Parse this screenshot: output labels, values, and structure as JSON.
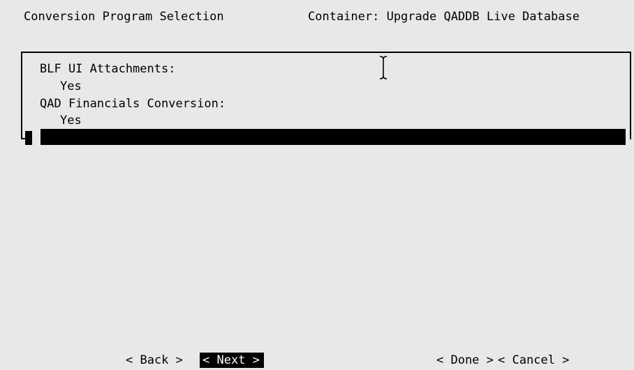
{
  "header": {
    "title": "Conversion Program Selection",
    "container": "Container: Upgrade QADDB Live Database"
  },
  "settings": [
    {
      "label": "BLF UI Attachments:",
      "value": "Yes"
    },
    {
      "label": "QAD Financials Conversion:",
      "value": "Yes"
    }
  ],
  "buttons": {
    "back": "< Back >",
    "next": "< Next >",
    "done": "< Done >",
    "cancel": "< Cancel >"
  }
}
